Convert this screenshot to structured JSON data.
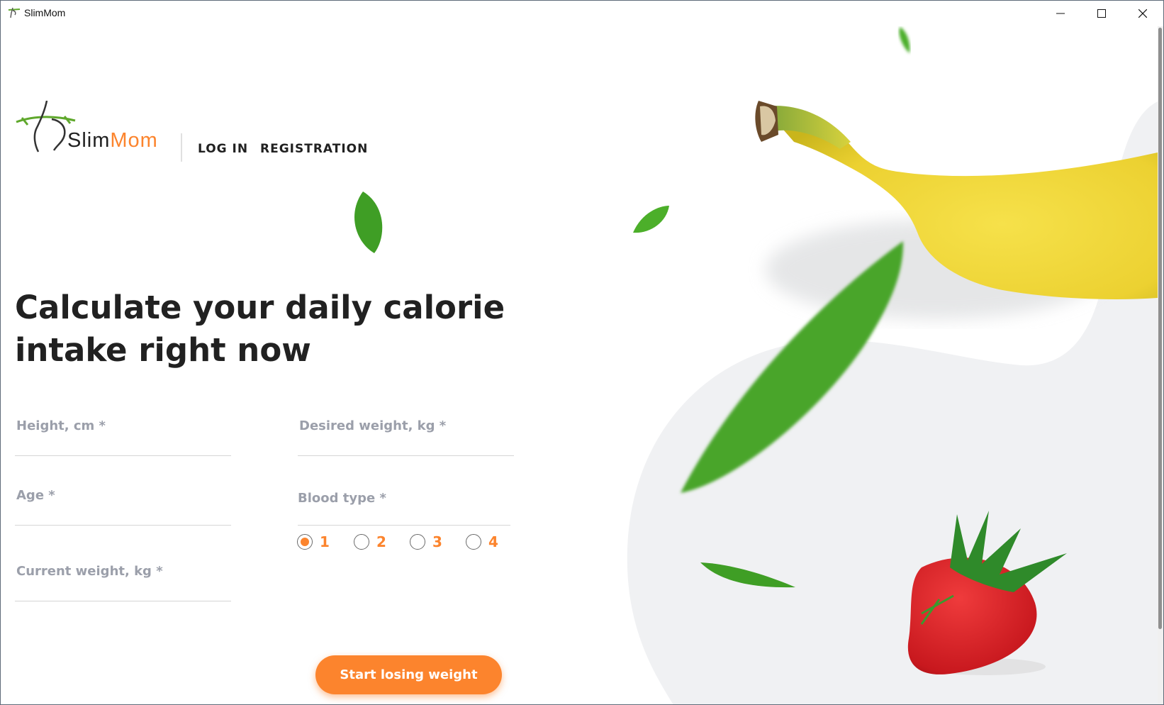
{
  "window": {
    "title": "SlimMom"
  },
  "logo": {
    "slim": "Slim",
    "mom": "Mom"
  },
  "nav": {
    "login": "LOG IN",
    "registration": "REGISTRATION"
  },
  "main": {
    "title": "Calculate your daily calorie intake right now",
    "fields": {
      "height": {
        "placeholder": "Height, cm *",
        "value": ""
      },
      "age": {
        "placeholder": "Age *",
        "value": ""
      },
      "current_weight": {
        "placeholder": "Current weight, kg *",
        "value": ""
      },
      "desired_weight": {
        "placeholder": "Desired weight, kg *",
        "value": ""
      }
    },
    "blood_type": {
      "label": "Blood type *",
      "options": [
        "1",
        "2",
        "3",
        "4"
      ],
      "selected": "1"
    },
    "cta": "Start losing weight"
  },
  "colors": {
    "accent": "#fc842d",
    "text": "#212121",
    "muted": "#9b9faa",
    "leaf": "#4caf2a",
    "banana": "#f2dc3a",
    "strawberry": "#d8262a"
  },
  "icons": [
    "app-icon",
    "minimize-icon",
    "maximize-icon",
    "close-icon",
    "leaf-icon",
    "banana-icon",
    "strawberry-icon"
  ]
}
